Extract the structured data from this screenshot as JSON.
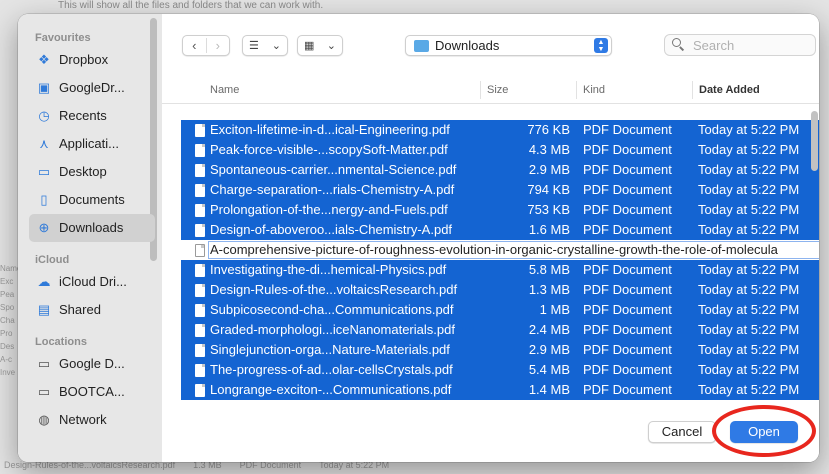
{
  "background": {
    "top_text": "This will show all the files and folders that we can work with.",
    "left_fragments": [
      "Name",
      "Exc",
      "Pea",
      "Spo",
      "Cha",
      "Pro",
      "Des",
      "A-c",
      "Inve"
    ],
    "bottom_row": [
      "Design-Rules-of-the...voltaicsResearch.pdf",
      "1.3 MB",
      "PDF Document",
      "Today at 5:22 PM"
    ]
  },
  "sidebar": {
    "sections": [
      {
        "title": "Favourites",
        "items": [
          {
            "label": "Dropbox",
            "icon": "dropbox-icon",
            "glyph": "❖",
            "active": false
          },
          {
            "label": "GoogleDr...",
            "icon": "drive-folder-icon",
            "glyph": "▣",
            "active": false
          },
          {
            "label": "Recents",
            "icon": "clock-icon",
            "glyph": "◷",
            "active": false
          },
          {
            "label": "Applicati...",
            "icon": "applications-icon",
            "glyph": "⋏",
            "active": false
          },
          {
            "label": "Desktop",
            "icon": "desktop-icon",
            "glyph": "▭",
            "active": false
          },
          {
            "label": "Documents",
            "icon": "document-icon",
            "glyph": "▯",
            "active": false
          },
          {
            "label": "Downloads",
            "icon": "download-icon",
            "glyph": "⊕",
            "active": true
          }
        ]
      },
      {
        "title": "iCloud",
        "items": [
          {
            "label": "iCloud Dri...",
            "icon": "cloud-icon",
            "glyph": "☁",
            "active": false
          },
          {
            "label": "Shared",
            "icon": "shared-folder-icon",
            "glyph": "▤",
            "active": false
          }
        ]
      },
      {
        "title": "Locations",
        "items": [
          {
            "label": "Google D...",
            "icon": "drive-icon",
            "glyph": "▭",
            "active": false
          },
          {
            "label": "BOOTCA...",
            "icon": "disk-icon",
            "glyph": "▭",
            "active": false
          },
          {
            "label": "Network",
            "icon": "globe-icon",
            "glyph": "◍",
            "active": false
          }
        ]
      }
    ]
  },
  "toolbar": {
    "back_glyph": "‹",
    "forward_glyph": "›",
    "list_view_glyph": "☰",
    "grid_view_glyph": "▦",
    "chevron_glyph": "⌄",
    "location": "Downloads",
    "stepper_glyph": "▲▼",
    "search_placeholder": "Search"
  },
  "table": {
    "columns": {
      "name": "Name",
      "size": "Size",
      "kind": "Kind",
      "date": "Date Added"
    },
    "rows": [
      {
        "name": "Exciton-lifetime-in-d...ical-Engineering.pdf",
        "size": "776 KB",
        "kind": "PDF Document",
        "date": "Today at 5:22 PM",
        "selected": true
      },
      {
        "name": "Peak-force-visible-...scopySoft-Matter.pdf",
        "size": "4.3 MB",
        "kind": "PDF Document",
        "date": "Today at 5:22 PM",
        "selected": true
      },
      {
        "name": "Spontaneous-carrier...nmental-Science.pdf",
        "size": "2.9 MB",
        "kind": "PDF Document",
        "date": "Today at 5:22 PM",
        "selected": true
      },
      {
        "name": "Charge-separation-...rials-Chemistry-A.pdf",
        "size": "794 KB",
        "kind": "PDF Document",
        "date": "Today at 5:22 PM",
        "selected": true
      },
      {
        "name": "Prolongation-of-the...nergy-and-Fuels.pdf",
        "size": "753 KB",
        "kind": "PDF Document",
        "date": "Today at 5:22 PM",
        "selected": true
      },
      {
        "name": "Design-of-aboveroo...ials-Chemistry-A.pdf",
        "size": "1.6 MB",
        "kind": "PDF Document",
        "date": "Today at 5:22 PM",
        "selected": true
      },
      {
        "name": "A-comprehensive-picture-of-roughness-evolution-in-organic-crystalline-growth-the-role-of-molecula",
        "size": "",
        "kind": "",
        "date": "",
        "selected": false
      },
      {
        "name": "Investigating-the-di...hemical-Physics.pdf",
        "size": "5.8 MB",
        "kind": "PDF Document",
        "date": "Today at 5:22 PM",
        "selected": true
      },
      {
        "name": "Design-Rules-of-the...voltaicsResearch.pdf",
        "size": "1.3 MB",
        "kind": "PDF Document",
        "date": "Today at 5:22 PM",
        "selected": true
      },
      {
        "name": "Subpicosecond-cha...Communications.pdf",
        "size": "1 MB",
        "kind": "PDF Document",
        "date": "Today at 5:22 PM",
        "selected": true
      },
      {
        "name": "Graded-morphologi...iceNanomaterials.pdf",
        "size": "2.4 MB",
        "kind": "PDF Document",
        "date": "Today at 5:22 PM",
        "selected": true
      },
      {
        "name": "Singlejunction-orga...Nature-Materials.pdf",
        "size": "2.9 MB",
        "kind": "PDF Document",
        "date": "Today at 5:22 PM",
        "selected": true
      },
      {
        "name": "The-progress-of-ad...olar-cellsCrystals.pdf",
        "size": "5.4 MB",
        "kind": "PDF Document",
        "date": "Today at 5:22 PM",
        "selected": true
      },
      {
        "name": "Longrange-exciton-...Communications.pdf",
        "size": "1.4 MB",
        "kind": "PDF Document",
        "date": "Today at 5:22 PM",
        "selected": true
      }
    ]
  },
  "footer": {
    "cancel_label": "Cancel",
    "open_label": "Open"
  },
  "colors": {
    "selection": "#1464d2",
    "accent": "#2f7ae5",
    "annotation_ring": "#e8271e"
  }
}
